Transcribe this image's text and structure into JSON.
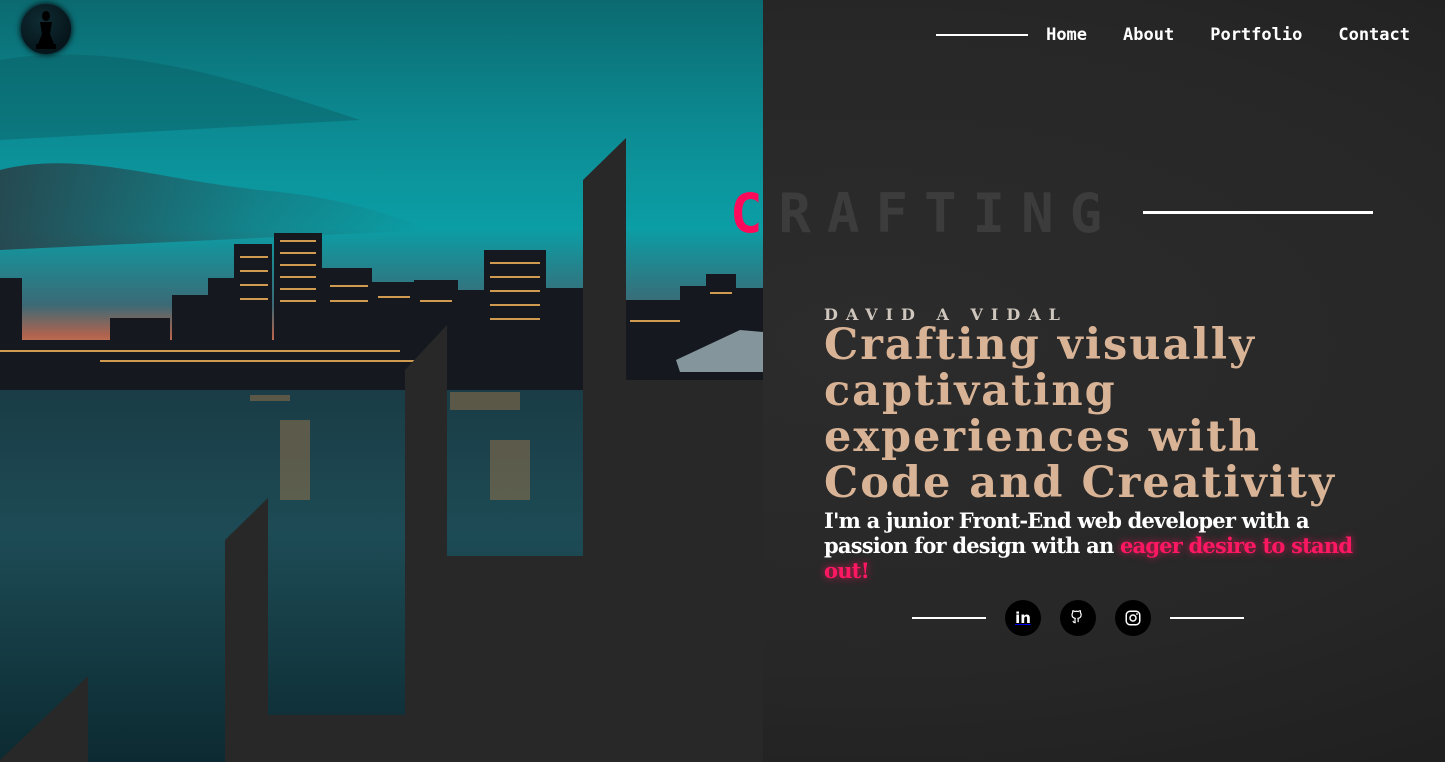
{
  "logo": {
    "icon": "chess-bishop-icon"
  },
  "nav": {
    "items": [
      "Home",
      "About",
      "Portfolio",
      "Contact"
    ]
  },
  "hero": {
    "big_word_first": "C",
    "big_word_rest": "RAFTING",
    "eyebrow": "DAVID A VIDAL",
    "headline_lines": [
      "Crafting visually",
      "captivating",
      "experiences with",
      "Code and Creativity"
    ],
    "intro_plain": "I'm a junior Front-End web developer with a passion for design with an ",
    "intro_highlight": "eager desire to stand out!",
    "image_description_icon": "city-skyline-image"
  },
  "social": {
    "icons": [
      "linkedin-icon",
      "github-icon",
      "instagram-icon"
    ],
    "linkedin_glyph": "in"
  },
  "colors": {
    "background": "#282828",
    "accent_pink": "#ff1762",
    "headline_tan": "#d9b395",
    "sky_teal": "#0fa3a8"
  }
}
